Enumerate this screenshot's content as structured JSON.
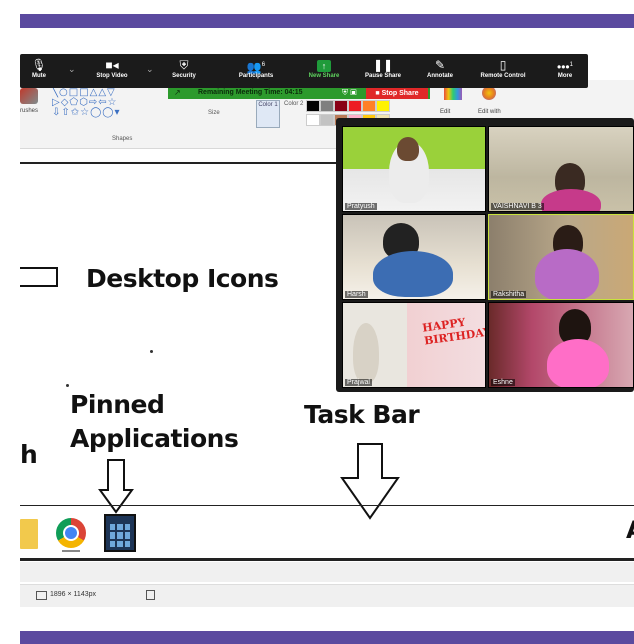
{
  "zoom_toolbar": {
    "items": [
      {
        "label": "Mute",
        "icon": "microphone-icon"
      },
      {
        "label": "Stop Video",
        "icon": "video-camera-icon"
      },
      {
        "label": "Security",
        "icon": "shield-icon"
      },
      {
        "label": "Participants",
        "icon": "participants-icon",
        "count": "6"
      },
      {
        "label": "New Share",
        "icon": "share-arrow-icon"
      },
      {
        "label": "Pause Share",
        "icon": "pause-icon"
      },
      {
        "label": "Annotate",
        "icon": "pencil-icon"
      },
      {
        "label": "Remote Control",
        "icon": "mouse-icon"
      },
      {
        "label": "More",
        "icon": "more-dots-icon",
        "count": "1"
      }
    ]
  },
  "share_bar": {
    "remaining": "Remaining Meeting Time: 04:15",
    "stop_label": "Stop Share"
  },
  "paint_ribbon": {
    "brushes_label": "rushes",
    "shapes_label": "Shapes",
    "size_label": "Size",
    "color1_label": "Color 1",
    "color2_label": "Color 2",
    "edit_colors_label": "Edit",
    "edit_paint3d_label": "Edit with",
    "palette": [
      "#000000",
      "#7f7f7f",
      "#880015",
      "#ed1c24",
      "#ff7f27",
      "#fff200",
      "#ffffff",
      "#c3c3c3",
      "#b97a57",
      "#ffaec9",
      "#ffc90e",
      "#efe4b0"
    ]
  },
  "gallery": {
    "participants": [
      "Pratyush",
      "VAISHNAVI B 3",
      "Harsh",
      "Rakshitha",
      "Prajwal",
      "Eshne"
    ],
    "banner_text": "HAPPY BIRTHDAY"
  },
  "canvas": {
    "desktop_icons": "Desktop Icons",
    "pinned_line1": "Pinned",
    "pinned_line2": "Applications",
    "task_bar": "Task Bar",
    "left_fragment": "h",
    "right_fragment": "A"
  },
  "taskbar_icons": [
    "folder-icon",
    "chrome-icon",
    "calculator-icon"
  ],
  "status_bar": {
    "dimensions": "1896 × 1143px"
  },
  "colors": {
    "band": "#5b4a9f",
    "zoom_toolbar_bg": "#1b1b1b",
    "share_green": "#2c9a2c",
    "stop_red": "#e02828"
  }
}
